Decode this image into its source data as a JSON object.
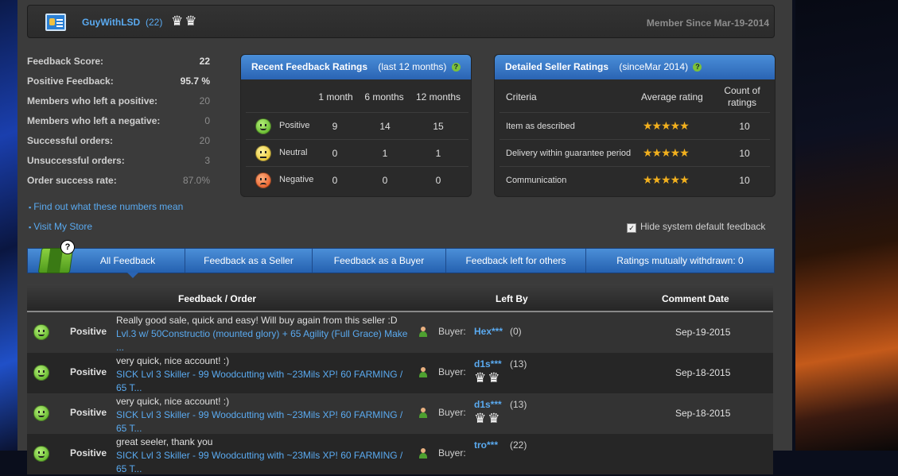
{
  "header": {
    "username": "GuyWithLSD",
    "user_count": "(22)",
    "crowns": "♛♛",
    "member_since": "Member Since Mar-19-2014"
  },
  "stats": [
    {
      "label": "Feedback Score:",
      "value": "22"
    },
    {
      "label": "Positive Feedback:",
      "value": "95.7 %"
    },
    {
      "label": "Members who left a positive:",
      "value": "20"
    },
    {
      "label": "Members who left a negative:",
      "value": "0"
    },
    {
      "label": "Successful orders:",
      "value": "20"
    },
    {
      "label": "Unsuccessful orders:",
      "value": "3"
    },
    {
      "label": "Order success rate:",
      "value": "87.0%"
    }
  ],
  "links": {
    "find_out": "Find out what these numbers mean",
    "visit_store": "Visit My Store"
  },
  "recent": {
    "title": "Recent Feedback Ratings",
    "subtitle": "(last 12 months)",
    "columns": [
      "1 month",
      "6 months",
      "12 months"
    ],
    "rows": [
      {
        "label": "Positive",
        "values": [
          "9",
          "14",
          "15"
        ]
      },
      {
        "label": "Neutral",
        "values": [
          "0",
          "1",
          "1"
        ]
      },
      {
        "label": "Negative",
        "values": [
          "0",
          "0",
          "0"
        ]
      }
    ]
  },
  "detailed": {
    "title": "Detailed Seller Ratings",
    "subtitle": "(sinceMar 2014)",
    "col_criteria": "Criteria",
    "col_average": "Average rating",
    "col_count": "Count of ratings",
    "rows": [
      {
        "criteria": "Item as described",
        "stars": "★★★★★",
        "rating": 5,
        "count": "10"
      },
      {
        "criteria": "Delivery within guarantee period",
        "stars": "★★★★★",
        "rating": 5,
        "count": "10"
      },
      {
        "criteria": "Communication",
        "stars": "★★★★★",
        "rating": 4.5,
        "count": "10"
      }
    ]
  },
  "hide_system": "Hide system default feedback",
  "tabs": [
    "All Feedback",
    "Feedback as a Seller",
    "Feedback as a Buyer",
    "Feedback left for others",
    "Ratings mutually withdrawn: 0"
  ],
  "table": {
    "col_feedback": "Feedback / Order",
    "col_left_by": "Left By",
    "col_date": "Comment Date",
    "rows": [
      {
        "type": "Positive",
        "comment": "Really good sale, quick and easy! Will buy again from this seller :D",
        "order": "Lvl.3 w/ 50Constructio (mounted glory) + 65 Agility (Full Grace) Make ...",
        "role": "Buyer:",
        "user": "Hex***",
        "user_count": "(0)",
        "crowns": "",
        "date": "Sep-19-2015"
      },
      {
        "type": "Positive",
        "comment": "very quick, nice account! :)",
        "order": "SICK Lvl 3 Skiller - 99 Woodcutting with ~23Mils XP! 60 FARMING / 65 T...",
        "role": "Buyer:",
        "user": "d1s***",
        "user_count": "(13)",
        "crowns": "♛♛",
        "date": "Sep-18-2015"
      },
      {
        "type": "Positive",
        "comment": "very quick, nice account! :)",
        "order": "SICK Lvl 3 Skiller - 99 Woodcutting with ~23Mils XP! 60 FARMING / 65 T...",
        "role": "Buyer:",
        "user": "d1s***",
        "user_count": "(13)",
        "crowns": "♛♛",
        "date": "Sep-18-2015"
      },
      {
        "type": "Positive",
        "comment": "great seeler, thank you",
        "order": "SICK Lvl 3 Skiller - 99 Woodcutting with ~23Mils XP! 60 FARMING / 65 T...",
        "role": "Buyer:",
        "user": "tro***",
        "user_count": "(22)",
        "crowns": "",
        "date": ""
      }
    ]
  }
}
